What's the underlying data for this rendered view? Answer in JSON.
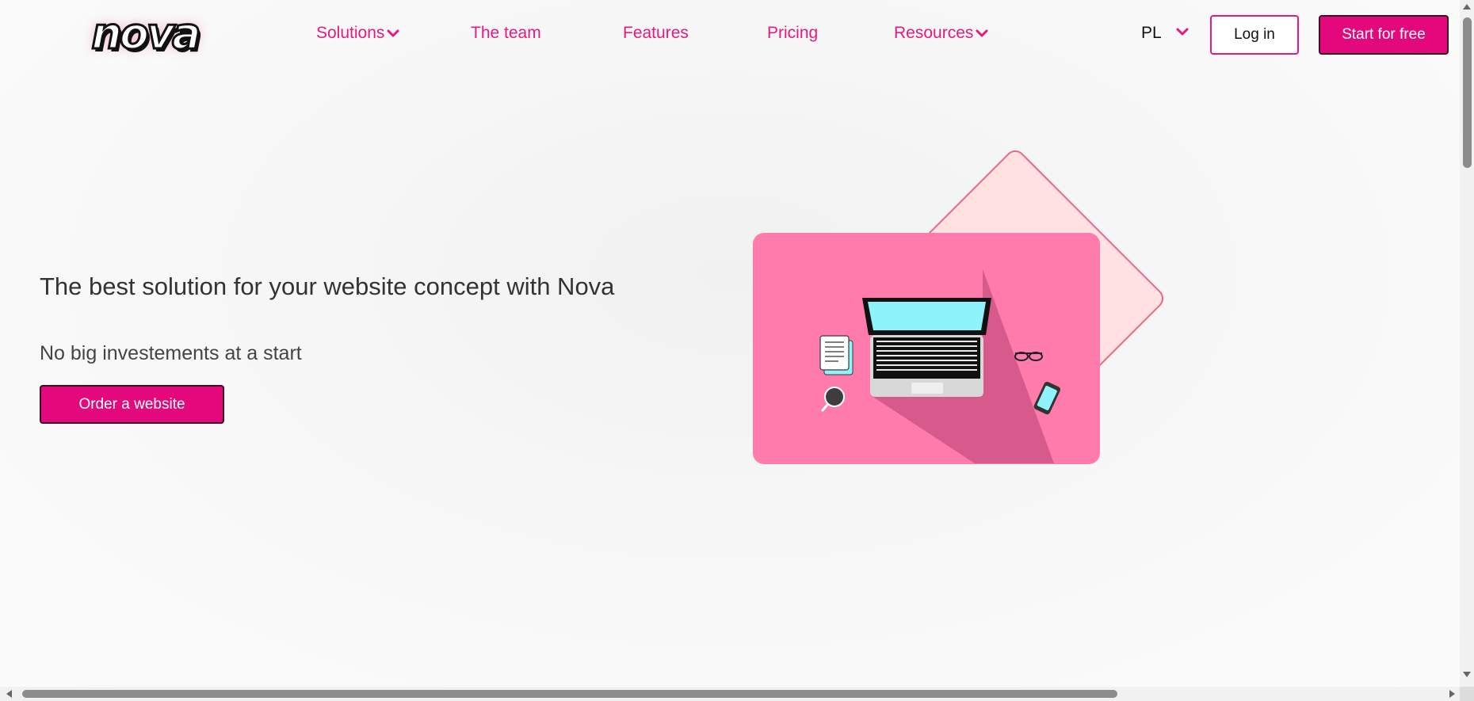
{
  "header": {
    "logo_text": "nova",
    "nav": [
      {
        "label": "Solutions",
        "has_dropdown": true
      },
      {
        "label": "The team",
        "has_dropdown": false
      },
      {
        "label": "Features",
        "has_dropdown": false
      },
      {
        "label": "Pricing",
        "has_dropdown": false
      },
      {
        "label": "Resources",
        "has_dropdown": true
      }
    ],
    "language": "PL",
    "login_label": "Log in",
    "start_label": "Start for free"
  },
  "hero": {
    "title": "The best solution for your website concept with Nova",
    "subtitle": "No big investements at a start",
    "cta_label": "Order a website"
  },
  "colors": {
    "accent": "#e3097d",
    "nav_text": "#e5197f",
    "card_pink": "#ff7bac",
    "diamond_fill": "#ffe1e1",
    "screen_cyan": "#8ff3fb"
  },
  "icons": [
    "chevron-down-icon",
    "laptop-illustration",
    "document-icon",
    "coffee-cup-icon",
    "glasses-icon",
    "phone-icon"
  ]
}
